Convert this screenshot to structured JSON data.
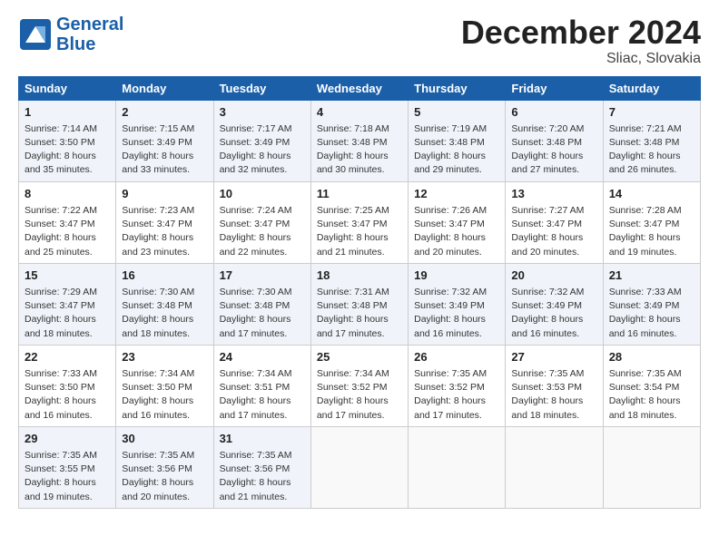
{
  "logo": {
    "line1": "General",
    "line2": "Blue"
  },
  "title": "December 2024",
  "subtitle": "Sliac, Slovakia",
  "weekdays": [
    "Sunday",
    "Monday",
    "Tuesday",
    "Wednesday",
    "Thursday",
    "Friday",
    "Saturday"
  ],
  "weeks": [
    [
      {
        "day": "1",
        "info": "Sunrise: 7:14 AM\nSunset: 3:50 PM\nDaylight: 8 hours\nand 35 minutes."
      },
      {
        "day": "2",
        "info": "Sunrise: 7:15 AM\nSunset: 3:49 PM\nDaylight: 8 hours\nand 33 minutes."
      },
      {
        "day": "3",
        "info": "Sunrise: 7:17 AM\nSunset: 3:49 PM\nDaylight: 8 hours\nand 32 minutes."
      },
      {
        "day": "4",
        "info": "Sunrise: 7:18 AM\nSunset: 3:48 PM\nDaylight: 8 hours\nand 30 minutes."
      },
      {
        "day": "5",
        "info": "Sunrise: 7:19 AM\nSunset: 3:48 PM\nDaylight: 8 hours\nand 29 minutes."
      },
      {
        "day": "6",
        "info": "Sunrise: 7:20 AM\nSunset: 3:48 PM\nDaylight: 8 hours\nand 27 minutes."
      },
      {
        "day": "7",
        "info": "Sunrise: 7:21 AM\nSunset: 3:48 PM\nDaylight: 8 hours\nand 26 minutes."
      }
    ],
    [
      {
        "day": "8",
        "info": "Sunrise: 7:22 AM\nSunset: 3:47 PM\nDaylight: 8 hours\nand 25 minutes."
      },
      {
        "day": "9",
        "info": "Sunrise: 7:23 AM\nSunset: 3:47 PM\nDaylight: 8 hours\nand 23 minutes."
      },
      {
        "day": "10",
        "info": "Sunrise: 7:24 AM\nSunset: 3:47 PM\nDaylight: 8 hours\nand 22 minutes."
      },
      {
        "day": "11",
        "info": "Sunrise: 7:25 AM\nSunset: 3:47 PM\nDaylight: 8 hours\nand 21 minutes."
      },
      {
        "day": "12",
        "info": "Sunrise: 7:26 AM\nSunset: 3:47 PM\nDaylight: 8 hours\nand 20 minutes."
      },
      {
        "day": "13",
        "info": "Sunrise: 7:27 AM\nSunset: 3:47 PM\nDaylight: 8 hours\nand 20 minutes."
      },
      {
        "day": "14",
        "info": "Sunrise: 7:28 AM\nSunset: 3:47 PM\nDaylight: 8 hours\nand 19 minutes."
      }
    ],
    [
      {
        "day": "15",
        "info": "Sunrise: 7:29 AM\nSunset: 3:47 PM\nDaylight: 8 hours\nand 18 minutes."
      },
      {
        "day": "16",
        "info": "Sunrise: 7:30 AM\nSunset: 3:48 PM\nDaylight: 8 hours\nand 18 minutes."
      },
      {
        "day": "17",
        "info": "Sunrise: 7:30 AM\nSunset: 3:48 PM\nDaylight: 8 hours\nand 17 minutes."
      },
      {
        "day": "18",
        "info": "Sunrise: 7:31 AM\nSunset: 3:48 PM\nDaylight: 8 hours\nand 17 minutes."
      },
      {
        "day": "19",
        "info": "Sunrise: 7:32 AM\nSunset: 3:49 PM\nDaylight: 8 hours\nand 16 minutes."
      },
      {
        "day": "20",
        "info": "Sunrise: 7:32 AM\nSunset: 3:49 PM\nDaylight: 8 hours\nand 16 minutes."
      },
      {
        "day": "21",
        "info": "Sunrise: 7:33 AM\nSunset: 3:49 PM\nDaylight: 8 hours\nand 16 minutes."
      }
    ],
    [
      {
        "day": "22",
        "info": "Sunrise: 7:33 AM\nSunset: 3:50 PM\nDaylight: 8 hours\nand 16 minutes."
      },
      {
        "day": "23",
        "info": "Sunrise: 7:34 AM\nSunset: 3:50 PM\nDaylight: 8 hours\nand 16 minutes."
      },
      {
        "day": "24",
        "info": "Sunrise: 7:34 AM\nSunset: 3:51 PM\nDaylight: 8 hours\nand 17 minutes."
      },
      {
        "day": "25",
        "info": "Sunrise: 7:34 AM\nSunset: 3:52 PM\nDaylight: 8 hours\nand 17 minutes."
      },
      {
        "day": "26",
        "info": "Sunrise: 7:35 AM\nSunset: 3:52 PM\nDaylight: 8 hours\nand 17 minutes."
      },
      {
        "day": "27",
        "info": "Sunrise: 7:35 AM\nSunset: 3:53 PM\nDaylight: 8 hours\nand 18 minutes."
      },
      {
        "day": "28",
        "info": "Sunrise: 7:35 AM\nSunset: 3:54 PM\nDaylight: 8 hours\nand 18 minutes."
      }
    ],
    [
      {
        "day": "29",
        "info": "Sunrise: 7:35 AM\nSunset: 3:55 PM\nDaylight: 8 hours\nand 19 minutes."
      },
      {
        "day": "30",
        "info": "Sunrise: 7:35 AM\nSunset: 3:56 PM\nDaylight: 8 hours\nand 20 minutes."
      },
      {
        "day": "31",
        "info": "Sunrise: 7:35 AM\nSunset: 3:56 PM\nDaylight: 8 hours\nand 21 minutes."
      },
      null,
      null,
      null,
      null
    ]
  ]
}
